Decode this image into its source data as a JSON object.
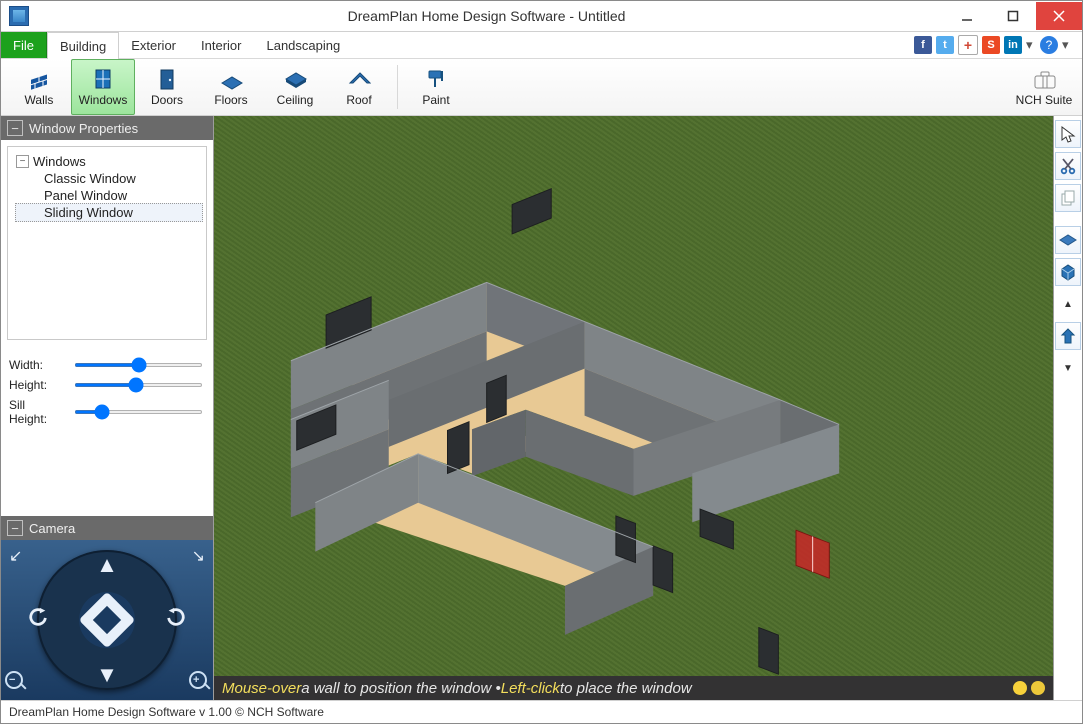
{
  "title": "DreamPlan Home Design Software - Untitled",
  "tabs": {
    "file": "File",
    "building": "Building",
    "exterior": "Exterior",
    "interior": "Interior",
    "landscaping": "Landscaping"
  },
  "toolbar": {
    "walls": "Walls",
    "windows": "Windows",
    "doors": "Doors",
    "floors": "Floors",
    "ceiling": "Ceiling",
    "roof": "Roof",
    "paint": "Paint",
    "nch": "NCH Suite"
  },
  "properties": {
    "header": "Window Properties",
    "tree_root": "Windows",
    "tree_items": [
      "Classic Window",
      "Panel Window",
      "Sliding Window"
    ],
    "width_label": "Width:",
    "height_label": "Height:",
    "sill_label": "Sill Height:"
  },
  "camera_header": "Camera",
  "hint": {
    "a": "Mouse-over",
    "b": " a wall to position the window • ",
    "c": "Left-click",
    "d": " to place the window"
  },
  "status": "DreamPlan Home Design Software v 1.00 © NCH Software"
}
